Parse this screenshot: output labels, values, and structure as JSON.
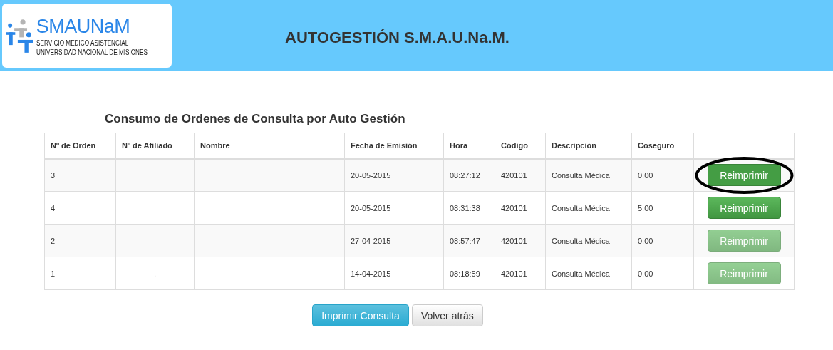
{
  "header": {
    "logo": {
      "name": "SMAUNaM",
      "line_1": "SERVICIO MEDICO ASISTENCIAL",
      "line_2": "UNIVERSIDAD NACIONAL DE MISIONES"
    },
    "title": "AUTOGESTIÓN S.M.A.U.Na.M."
  },
  "section_title": "Consumo de Ordenes de Consulta por Auto Gestión",
  "table": {
    "columns": [
      "Nº de Orden",
      "Nº de Afiliado",
      "Nombre",
      "Fecha de Emisión",
      "Hora",
      "Código",
      "Descripción",
      "Coseguro"
    ],
    "rows": [
      {
        "cells": [
          "3",
          "",
          "",
          "20-05-2015",
          "08:27:12",
          "420101",
          "Consulta Médica",
          "0.00"
        ],
        "button": {
          "label": "Reimprimir",
          "disabled": false,
          "hovered": true,
          "circled": true
        }
      },
      {
        "cells": [
          "4",
          "",
          "",
          "20-05-2015",
          "08:31:38",
          "420101",
          "Consulta Médica",
          "5.00"
        ],
        "button": {
          "label": "Reimprimir",
          "disabled": false,
          "hovered": false,
          "circled": false
        }
      },
      {
        "cells": [
          "2",
          "",
          "",
          "27-04-2015",
          "08:57:47",
          "420101",
          "Consulta Médica",
          "0.00"
        ],
        "button": {
          "label": "Reimprimir",
          "disabled": true,
          "hovered": false,
          "circled": false
        }
      },
      {
        "cells": [
          "1",
          ".",
          "",
          "14-04-2015",
          "08:18:59",
          "420101",
          "Consulta Médica",
          "0.00"
        ],
        "button": {
          "label": "Reimprimir",
          "disabled": true,
          "hovered": false,
          "circled": false
        }
      }
    ]
  },
  "actions": [
    {
      "label": "Imprimir Consulta",
      "kind": "primary"
    },
    {
      "label": "Volver atrás",
      "kind": "default"
    }
  ]
}
